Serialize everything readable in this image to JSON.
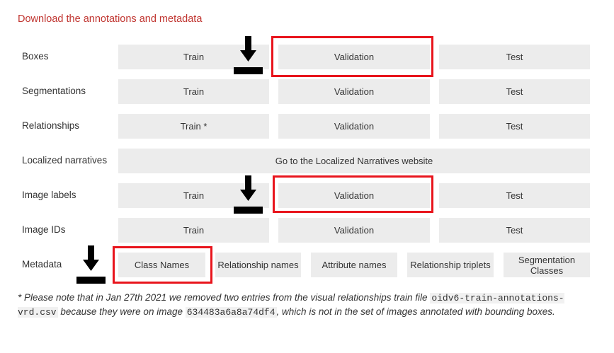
{
  "page": {
    "title": "Download the annotations and metadata"
  },
  "rows": {
    "boxes": {
      "label": "Boxes",
      "train": "Train",
      "validation": "Validation",
      "test": "Test"
    },
    "segmentations": {
      "label": "Segmentations",
      "train": "Train",
      "validation": "Validation",
      "test": "Test"
    },
    "relationships": {
      "label": "Relationships",
      "train": "Train *",
      "validation": "Validation",
      "test": "Test"
    },
    "narratives": {
      "label": "Localized narratives",
      "link": "Go to the Localized Narratives website"
    },
    "image_labels": {
      "label": "Image labels",
      "train": "Train",
      "validation": "Validation",
      "test": "Test"
    },
    "image_ids": {
      "label": "Image IDs",
      "train": "Train",
      "validation": "Validation",
      "test": "Test"
    },
    "metadata": {
      "label": "Metadata",
      "class_names": "Class Names",
      "relationship_names": "Relationship names",
      "attribute_names": "Attribute names",
      "relationship_triplets": "Relationship triplets",
      "segmentation_classes": "Segmentation Classes"
    }
  },
  "footnote": {
    "part1": "* Please note that in Jan 27th 2021 we removed two entries from the visual relationships train file ",
    "file": "oidv6-train-annotations-vrd.csv",
    "part2": " because they were on image ",
    "image_id": "634483a6a8a74df4",
    "part3": ", which is not in the set of images annotated with bounding boxes."
  },
  "annotations": {
    "highlight_color": "#e8141c",
    "arrow_icon": "down-arrow-icon"
  }
}
